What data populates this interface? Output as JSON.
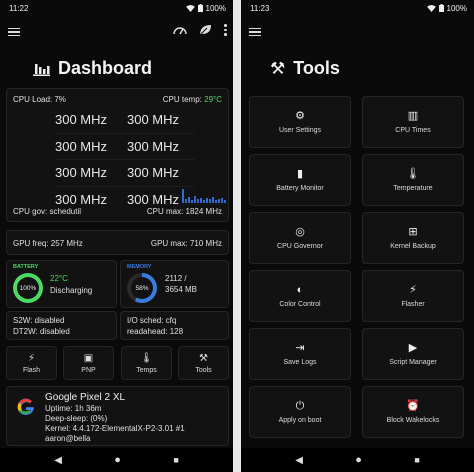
{
  "left": {
    "status_time": "11:22",
    "battery": "100%",
    "title": "Dashboard",
    "cpu": {
      "load_label": "CPU Load: 7%",
      "temp_label": "CPU temp:",
      "temp_value": "29°C",
      "freqs": [
        [
          "300 MHz",
          "300 MHz"
        ],
        [
          "300 MHz",
          "300 MHz"
        ],
        [
          "300 MHz",
          "300 MHz"
        ],
        [
          "300 MHz",
          "300 MHz"
        ]
      ],
      "gov": "CPU gov: schedutil",
      "max": "CPU max: 1824 MHz"
    },
    "gpu": {
      "freq": "GPU freq: 257 MHz",
      "max": "GPU max: 710 MHz"
    },
    "battery_card": {
      "label": "BATTERY",
      "percent": "100%",
      "temp": "22°C",
      "state": "Discharging",
      "color": "#4cd964"
    },
    "memory_card": {
      "label": "MEMORY",
      "percent": "58%",
      "used": "2112 /",
      "total": "3654 MB",
      "color": "#3b7be0"
    },
    "misc": {
      "s2w": "S2W: disabled",
      "dt2w": "DT2W: disabled",
      "io": "I/O sched: cfq",
      "readahead": "readahead: 128"
    },
    "quick": [
      {
        "label": "Flash",
        "icon": "⚡"
      },
      {
        "label": "PNP",
        "icon": "▣"
      },
      {
        "label": "Temps",
        "icon": "🌡"
      },
      {
        "label": "Tools",
        "icon": "⚒"
      }
    ],
    "device": {
      "name": "Google Pixel 2 XL",
      "uptime": "Uptime: 1h 36m",
      "deep_sleep": "Deep-sleep:  (0%)",
      "kernel": "Kernel: 4.4.172-ElementalX-P2-3.01 #1",
      "user": "aaron@bella"
    }
  },
  "right": {
    "status_time": "11:23",
    "battery": "100%",
    "title": "Tools",
    "tools": [
      {
        "label": "User Settings",
        "icon": "⚙"
      },
      {
        "label": "CPU Times",
        "icon": "▥"
      },
      {
        "label": "Battery Monitor",
        "icon": "▮"
      },
      {
        "label": "Temperature",
        "icon": "🌡"
      },
      {
        "label": "CPU Governor",
        "icon": "◎"
      },
      {
        "label": "Kernel Backup",
        "icon": "⊞"
      },
      {
        "label": "Color Control",
        "icon": "◐"
      },
      {
        "label": "Flasher",
        "icon": "⚡"
      },
      {
        "label": "Save Logs",
        "icon": "⇥"
      },
      {
        "label": "Script Manager",
        "icon": "▶"
      },
      {
        "label": "Apply on boot",
        "icon": "⏻"
      },
      {
        "label": "Block Wakelocks",
        "icon": "⏰"
      }
    ]
  },
  "nav": {
    "back": "◀",
    "home": "●",
    "recents": "■"
  }
}
